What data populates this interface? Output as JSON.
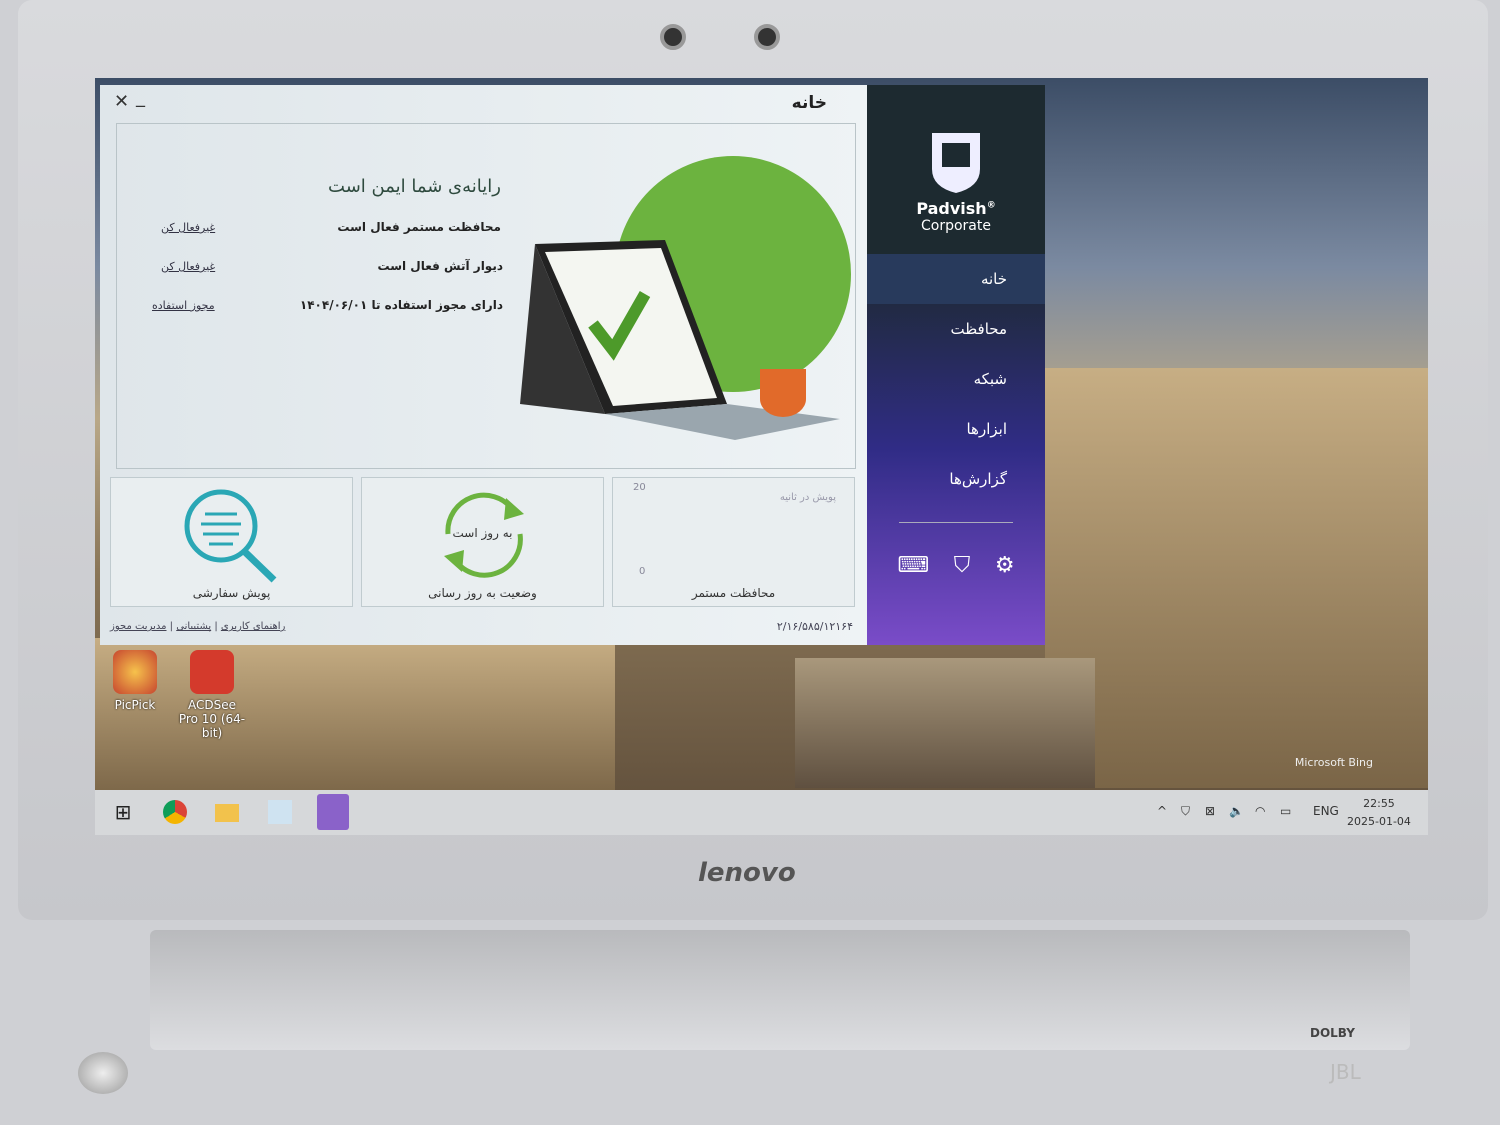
{
  "app": {
    "window_title": "خانه",
    "minimize": "_",
    "close": "✕",
    "brand": {
      "name": "Padvish",
      "reg": "®",
      "edition": "Corporate"
    },
    "nav": [
      {
        "label": "خانه",
        "active": true
      },
      {
        "label": "محافظت"
      },
      {
        "label": "شبکه"
      },
      {
        "label": "ابزارها"
      },
      {
        "label": "گزارش‌ها"
      }
    ],
    "bottom_icons": [
      "keyboard-icon",
      "usb-shield-icon",
      "gear-icon"
    ],
    "status": {
      "headline": "رایانه‌ی شما ایمن است",
      "rows": [
        {
          "text": "محافظت مستمر فعال است",
          "action": "غیرفعال کن"
        },
        {
          "text": "دیوار آتش فعال است",
          "action": "غیرفعال کن"
        },
        {
          "text": "دارای مجوز استفاده تا ۱۴۰۴/۰۶/۰۱",
          "action": "مجوز استفاده"
        }
      ]
    },
    "tiles": {
      "custom_scan": "پویش سفارشی",
      "update_status": "وضعیت به روز رسانی",
      "update_badge": "به روز است",
      "realtime": "محافظت مستمر",
      "chart_title": "پویش در ثانیه",
      "chart_max": "20",
      "chart_min": "0"
    },
    "footer": {
      "links": [
        "راهنمای کاربری",
        "پشتیبانی",
        "مدیریت مجوز"
      ],
      "version": "۲/۱۶/۵۸۵/۱۲۱۶۴"
    },
    "colors": {
      "sidebar": "#1d2a30",
      "accent_green": "#6cb33f",
      "scan_teal": "#2aa7b5"
    }
  },
  "desktop": {
    "icons": [
      {
        "label": "PicPick"
      },
      {
        "label": "ACDSee Pro 10 (64-bit)"
      }
    ],
    "watermark": "Microsoft Bing"
  },
  "taskbar": {
    "apps": [
      "windows-start-icon",
      "chrome-icon",
      "file-explorer-icon",
      "notepad-icon",
      "padvish-icon"
    ],
    "lang": "ENG",
    "time": "22:55",
    "date": "2025-01-04"
  },
  "laptop": {
    "brand": "lenovo",
    "dolby": "DOLBY",
    "jbl": "JBL"
  }
}
